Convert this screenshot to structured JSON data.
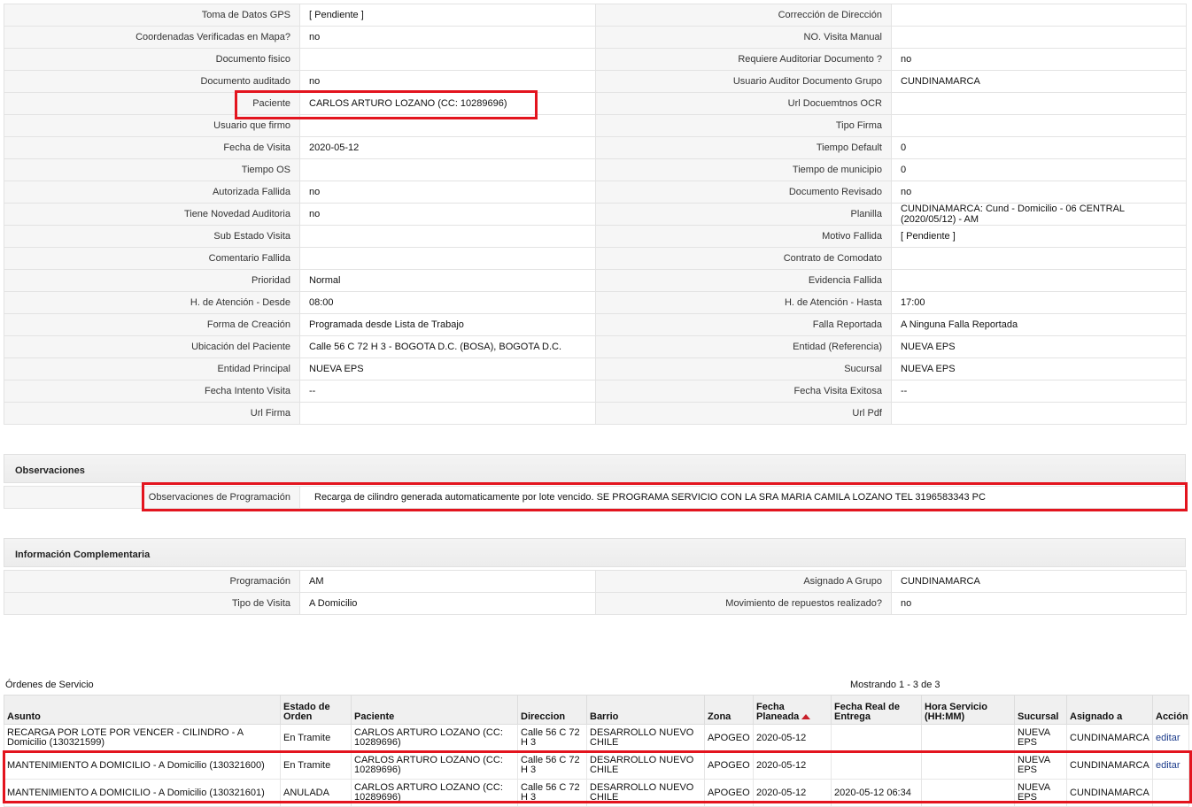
{
  "details": {
    "rows": [
      {
        "l1": "Toma de Datos GPS",
        "v1": "[ Pendiente ]",
        "l2": "Corrección de Dirección",
        "v2": ""
      },
      {
        "l1": "Coordenadas Verificadas en Mapa?",
        "v1": "no",
        "l2": "NO. Visita Manual",
        "v2": ""
      },
      {
        "l1": "Documento fisico",
        "v1": "",
        "l2": "Requiere Auditoriar Documento ?",
        "v2": "no"
      },
      {
        "l1": "Documento auditado",
        "v1": "no",
        "l2": "Usuario Auditor Documento Grupo",
        "v2": "CUNDINAMARCA"
      },
      {
        "l1": "Paciente",
        "v1": "CARLOS ARTURO LOZANO (CC: 10289696)",
        "l2": "Url Docuemtnos OCR",
        "v2": ""
      },
      {
        "l1": "Usuario que firmo",
        "v1": "",
        "l2": "Tipo Firma",
        "v2": ""
      },
      {
        "l1": "Fecha de Visita",
        "v1": "2020-05-12",
        "l2": "Tiempo Default",
        "v2": "0"
      },
      {
        "l1": "Tiempo OS",
        "v1": "",
        "l2": "Tiempo de municipio",
        "v2": "0"
      },
      {
        "l1": "Autorizada Fallida",
        "v1": "no",
        "l2": "Documento Revisado",
        "v2": "no"
      },
      {
        "l1": "Tiene Novedad Auditoria",
        "v1": "no",
        "l2": "Planilla",
        "v2": "CUNDINAMARCA: Cund - Domicilio - 06 CENTRAL (2020/05/12) - AM"
      },
      {
        "l1": "Sub Estado Visita",
        "v1": "",
        "l2": "Motivo Fallida",
        "v2": "[ Pendiente ]"
      },
      {
        "l1": "Comentario Fallida",
        "v1": "",
        "l2": "Contrato de Comodato",
        "v2": ""
      },
      {
        "l1": "Prioridad",
        "v1": "Normal",
        "l2": "Evidencia Fallida",
        "v2": ""
      },
      {
        "l1": "H. de Atención - Desde",
        "v1": "08:00",
        "l2": "H. de Atención - Hasta",
        "v2": "17:00"
      },
      {
        "l1": "Forma de Creación",
        "v1": "Programada desde Lista de Trabajo",
        "l2": "Falla Reportada",
        "v2": "A Ninguna Falla Reportada"
      },
      {
        "l1": "Ubicación del Paciente",
        "v1": "Calle 56 C 72 H 3 - BOGOTA D.C. (BOSA), BOGOTA D.C.",
        "l2": "Entidad (Referencia)",
        "v2": "NUEVA EPS"
      },
      {
        "l1": "Entidad Principal",
        "v1": "NUEVA EPS",
        "l2": "Sucursal",
        "v2": "NUEVA EPS"
      },
      {
        "l1": "Fecha Intento Visita",
        "v1": "--",
        "l2": "Fecha Visita Exitosa",
        "v2": "--"
      },
      {
        "l1": "Url Firma",
        "v1": "",
        "l2": "Url Pdf",
        "v2": ""
      }
    ]
  },
  "observaciones": {
    "title": "Observaciones",
    "label": "Observaciones de Programación",
    "value": "Recarga de cilindro generada automaticamente por lote vencido. SE PROGRAMA SERVICIO CON LA SRA MARIA CAMILA LOZANO TEL 3196583343 PC"
  },
  "complementaria": {
    "title": "Información Complementaria",
    "rows": [
      {
        "l1": "Programación",
        "v1": "AM",
        "l2": "Asignado A Grupo",
        "v2": "CUNDINAMARCA"
      },
      {
        "l1": "Tipo de Visita",
        "v1": "A Domicilio",
        "l2": "Movimiento de repuestos realizado?",
        "v2": "no"
      }
    ]
  },
  "ordenes": {
    "title": "Órdenes de Servicio",
    "count": "Mostrando 1 - 3 de 3",
    "headers": [
      "Asunto",
      "Estado de Orden",
      "Paciente",
      "Direccion",
      "Barrio",
      "Zona",
      "Fecha Planeada",
      "Fecha Real de Entrega",
      "Hora Servicio (HH:MM)",
      "Sucursal",
      "Asignado a",
      "Acción"
    ],
    "rows": [
      [
        "RECARGA POR LOTE POR VENCER - CILINDRO - A Domicilio (130321599)",
        "En Tramite",
        "CARLOS ARTURO LOZANO (CC: 10289696)",
        "Calle 56 C 72 H 3",
        "DESARROLLO NUEVO CHILE",
        "APOGEO",
        "2020-05-12",
        "",
        "",
        "NUEVA EPS",
        "CUNDINAMARCA",
        "editar"
      ],
      [
        "MANTENIMIENTO A DOMICILIO - A Domicilio (130321600)",
        "En Tramite",
        "CARLOS ARTURO LOZANO (CC: 10289696)",
        "Calle 56 C 72 H 3",
        "DESARROLLO NUEVO CHILE",
        "APOGEO",
        "2020-05-12",
        "",
        "",
        "NUEVA EPS",
        "CUNDINAMARCA",
        "editar"
      ],
      [
        "MANTENIMIENTO A DOMICILIO - A Domicilio (130321601)",
        "ANULADA",
        "CARLOS ARTURO LOZANO (CC: 10289696)",
        "Calle 56 C 72 H 3",
        "DESARROLLO NUEVO CHILE",
        "APOGEO",
        "2020-05-12",
        "2020-05-12 06:34",
        "",
        "NUEVA EPS",
        "CUNDINAMARCA",
        ""
      ]
    ]
  },
  "colors": {
    "highlight": "#e3141e",
    "label_bg": "#f6f6f6",
    "link": "#1a3a8a"
  }
}
